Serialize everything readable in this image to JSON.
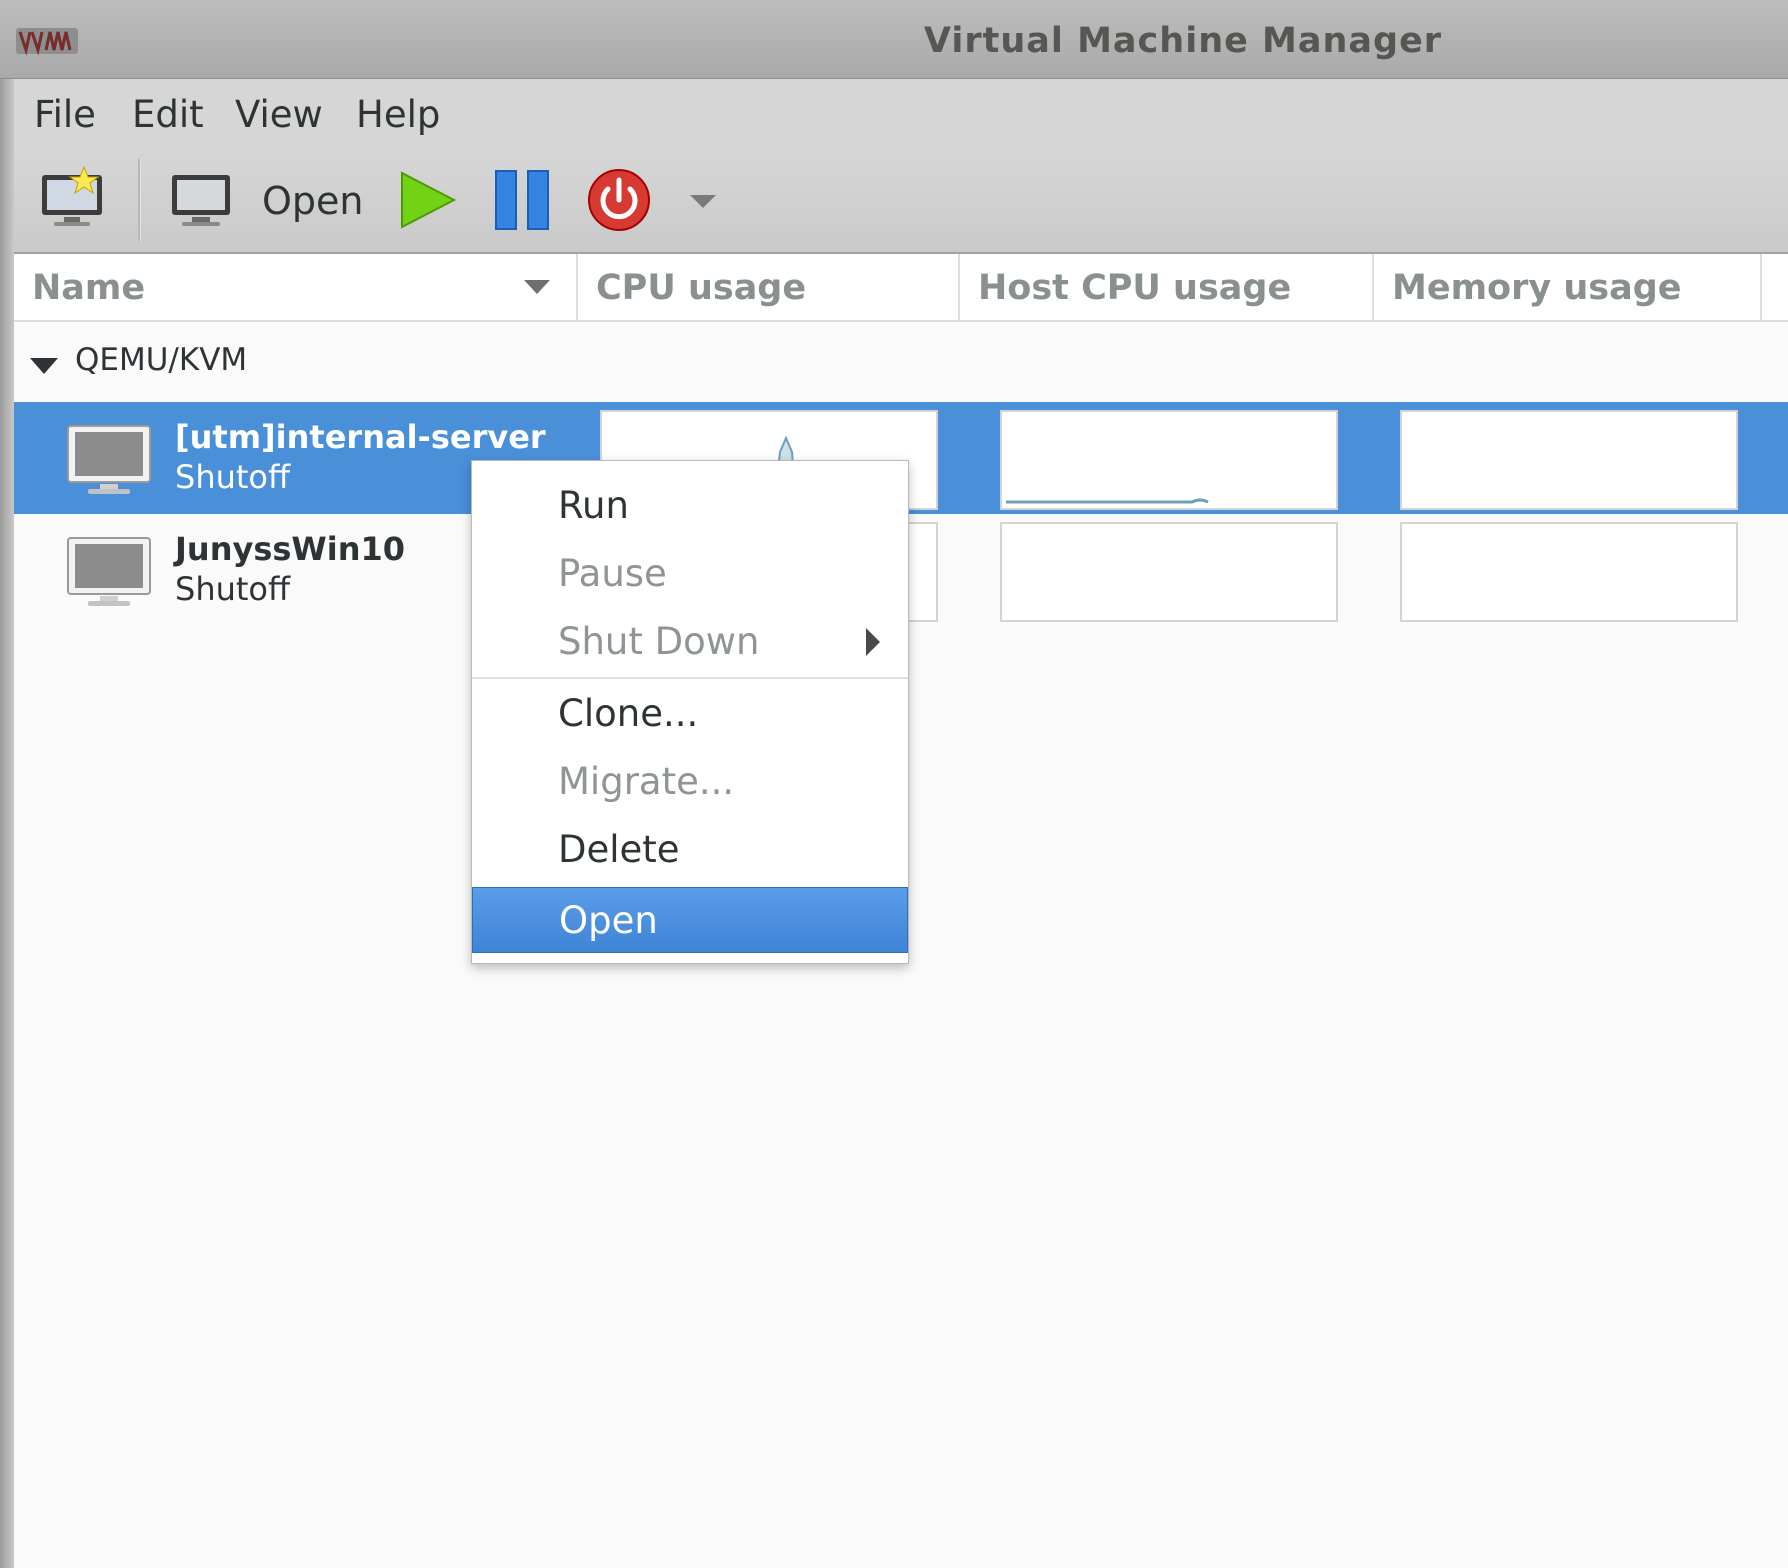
{
  "window": {
    "title": "Virtual Machine Manager",
    "logo_icon": "virt-manager-logo-icon"
  },
  "menubar": {
    "items": [
      "File",
      "Edit",
      "View",
      "Help"
    ]
  },
  "toolbar": {
    "new_vm_icon": "new-vm-icon",
    "open_icon": "monitor-icon",
    "open_label": "Open",
    "run_icon": "play-icon",
    "pause_icon": "pause-icon",
    "shutdown_icon": "power-icon",
    "shutdown_menu_icon": "chevron-down-icon",
    "colors": {
      "run": "#73d216",
      "pause": "#3584e4",
      "shutdown": "#cc0000"
    }
  },
  "columns": {
    "name": "Name",
    "cpu": "CPU usage",
    "host_cpu": "Host CPU usage",
    "memory": "Memory usage"
  },
  "list": {
    "group_label": "QEMU/KVM",
    "vms": [
      {
        "name": "[utm]internal-server",
        "status": "Shutoff",
        "selected": true
      },
      {
        "name": "JunyssWin10",
        "status": "Shutoff",
        "selected": false
      }
    ]
  },
  "context_menu": {
    "run": "Run",
    "pause": "Pause",
    "shutdown": "Shut Down",
    "clone": "Clone...",
    "migrate": "Migrate...",
    "delete": "Delete",
    "open": "Open"
  },
  "colors": {
    "selection": "#4a90d9",
    "menu_highlight": "#4a90d9"
  }
}
